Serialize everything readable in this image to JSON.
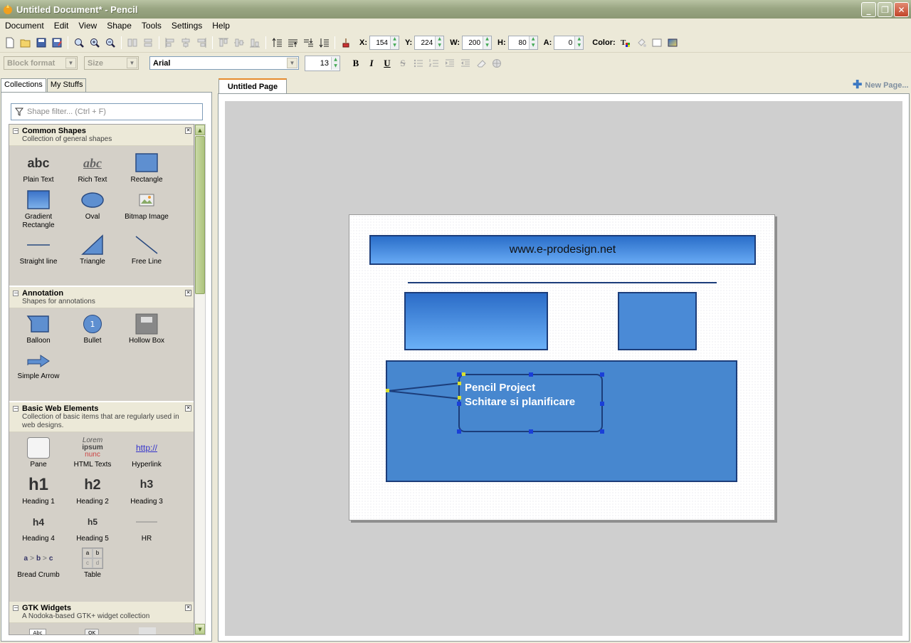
{
  "window": {
    "title": "Untitled Document* - Pencil"
  },
  "menu": [
    "Document",
    "Edit",
    "View",
    "Shape",
    "Tools",
    "Settings",
    "Help"
  ],
  "geometry": {
    "x_label": "X:",
    "x": "154",
    "y_label": "Y:",
    "y": "224",
    "w_label": "W:",
    "w": "200",
    "h_label": "H:",
    "h": "80",
    "a_label": "A:",
    "a": "0",
    "color_label": "Color:"
  },
  "format": {
    "block": "Block format",
    "size": "Size",
    "font": "Arial",
    "font_size": "13",
    "bold": "B",
    "italic": "I",
    "underline": "U",
    "strike": "S"
  },
  "left_tabs": [
    "Collections",
    "My Stuffs"
  ],
  "filter": {
    "placeholder": "Shape filter... (Ctrl + F)"
  },
  "collections": [
    {
      "title": "Common Shapes",
      "desc": "Collection of general shapes",
      "items": [
        "Plain Text",
        "Rich Text",
        "Rectangle",
        "Gradient Rectangle",
        "Oval",
        "Bitmap Image",
        "Straight line",
        "Triangle",
        "Free Line"
      ]
    },
    {
      "title": "Annotation",
      "desc": "Shapes for annotations",
      "items": [
        "Balloon",
        "Bullet",
        "Hollow Box",
        "Simple Arrow"
      ]
    },
    {
      "title": "Basic Web Elements",
      "desc": "Collection of basic items that are regularly used in web designs.",
      "items": [
        "Pane",
        "HTML Texts",
        "Hyperlink",
        "Heading 1",
        "Heading 2",
        "Heading 3",
        "Heading 4",
        "Heading 5",
        "HR",
        "Bread Crumb",
        "Table"
      ]
    },
    {
      "title": "GTK Widgets",
      "desc": "A Nodoka-based GTK+ widget collection"
    }
  ],
  "icon_text": {
    "plain": "abc",
    "rich": "abc",
    "bullet": "1",
    "lorem": "Lorem",
    "ipsum": "ipsum",
    "nunc": "nunc",
    "hyperlink": "http://",
    "h1": "h1",
    "h2": "h2",
    "h3": "h3",
    "h4": "h4",
    "h5": "h5",
    "crumb_a": "a",
    "crumb_b": "b",
    "crumb_c": "c",
    "gt": ">",
    "table_cells": [
      "a",
      "b",
      "c",
      "d"
    ],
    "gtk_1": "Abc",
    "gtk_2": "OK"
  },
  "page_tab": "Untitled Page",
  "new_page": "New Page...",
  "canvas": {
    "header_text": "www.e-prodesign.net",
    "balloon_line1": "Pencil Project",
    "balloon_line2": "Schitare si planificare"
  },
  "colors": {
    "header_top": "#2a6ec9",
    "header_bottom": "#68aaf4",
    "box_fill": "#4787cf",
    "border": "#1c3d7a",
    "canvas_bg": "#cfcfcf"
  }
}
